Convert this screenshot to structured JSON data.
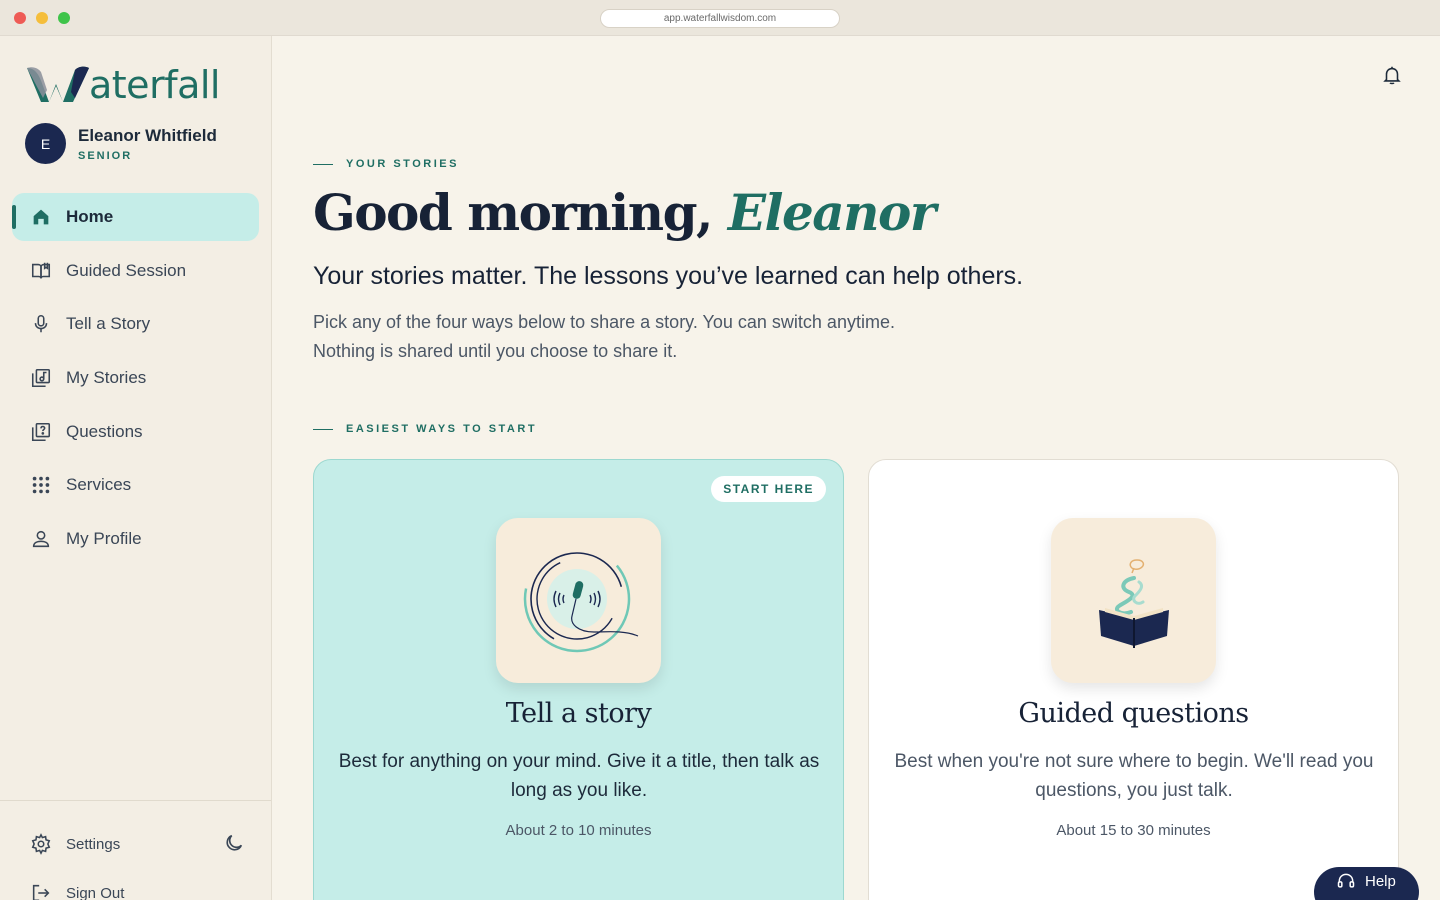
{
  "browser": {
    "url": "app.waterfallwisdom.com"
  },
  "sidebar": {
    "logo_text": "aterfall",
    "user": {
      "initial": "E",
      "name": "Eleanor Whitfield",
      "role": "SENIOR"
    },
    "items": [
      {
        "label": "Home",
        "icon": "home-icon",
        "active": true
      },
      {
        "label": "Guided Session",
        "icon": "open-book-icon"
      },
      {
        "label": "Tell a Story",
        "icon": "microphone-icon"
      },
      {
        "label": "My Stories",
        "icon": "music-library-icon"
      },
      {
        "label": "Questions",
        "icon": "question-library-icon"
      },
      {
        "label": "Services",
        "icon": "grid-dots-icon"
      },
      {
        "label": "My Profile",
        "icon": "person-icon"
      }
    ],
    "settings_label": "Settings",
    "signout_label": "Sign Out"
  },
  "main": {
    "eyebrow": "YOUR STORIES",
    "greeting_prefix": "Good morning,",
    "greeting_name": "Eleanor",
    "subhead": "Your stories matter. The lessons you’ve learned can help others.",
    "intro_line1": "Pick any of the four ways below to share a story. You can switch anytime.",
    "intro_line2": "Nothing is shared until you choose to share it.",
    "section_eyebrow": "EASIEST WAYS TO START",
    "cards": [
      {
        "badge": "START HERE",
        "title": "Tell a story",
        "description": "Best for anything on your mind. Give it a title, then talk as long as you like.",
        "time": "About 2 to 10 minutes"
      },
      {
        "title": "Guided questions",
        "description": "Best when you're not sure where to begin. We'll read you questions, you just talk.",
        "time": "About 15 to 30 minutes"
      }
    ]
  },
  "help_label": "Help",
  "colors": {
    "accent": "#1f6e63",
    "navy": "#1b2850",
    "mint": "#c5ede8",
    "background": "#f7f3ea"
  }
}
